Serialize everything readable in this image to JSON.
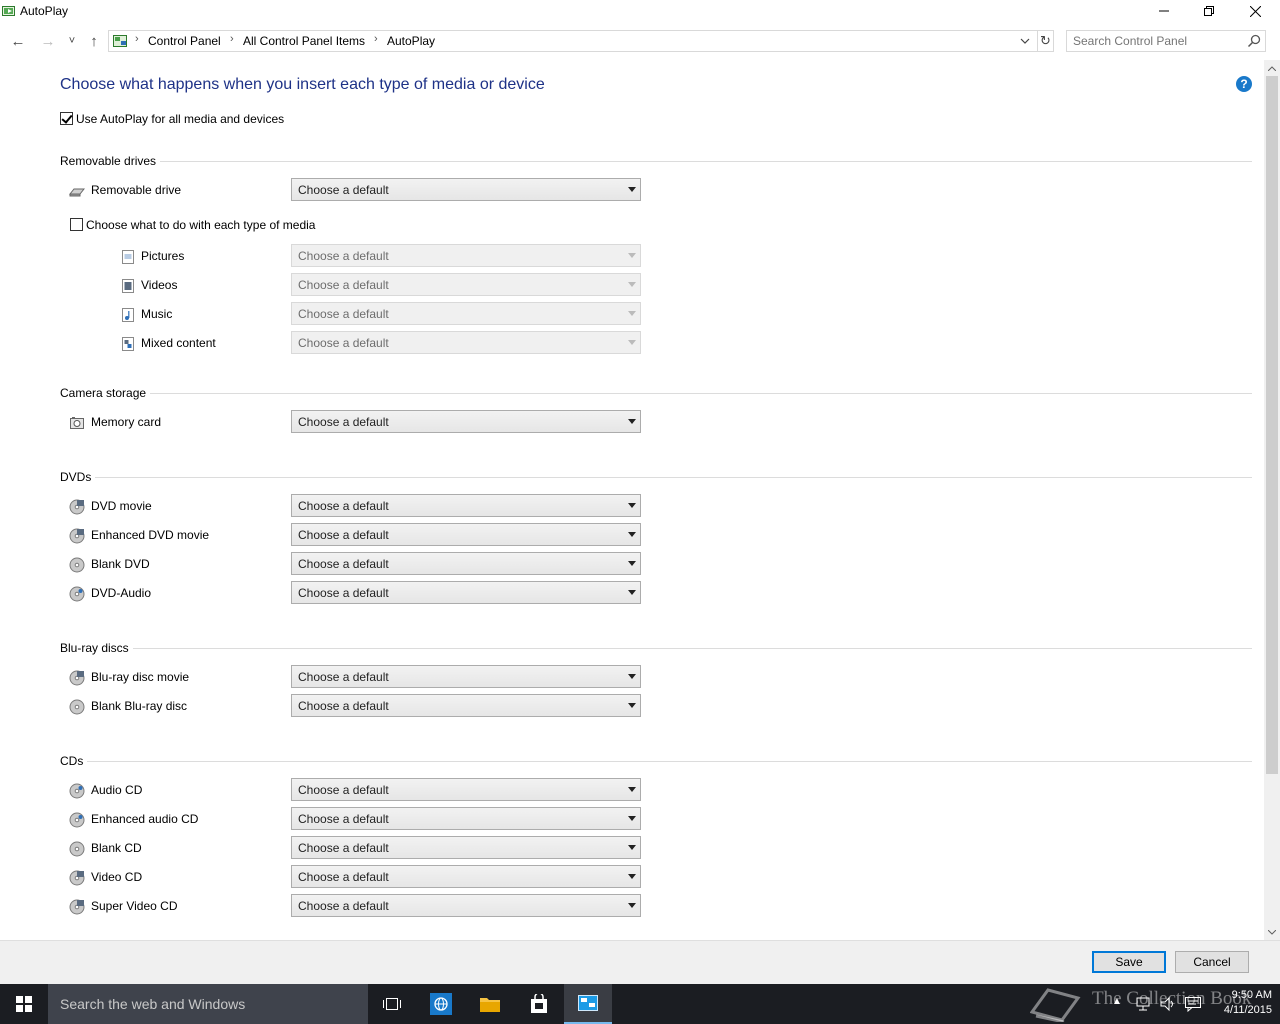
{
  "window": {
    "title": "AutoPlay",
    "controls": {
      "minimize": "─",
      "maximize": "❐",
      "close": "✕"
    }
  },
  "nav": {
    "back": "←",
    "forward": "→",
    "recent": "˅",
    "up": "↑",
    "breadcrumb": [
      "Control Panel",
      "All Control Panel Items",
      "AutoPlay"
    ],
    "refresh": "↻",
    "search_placeholder": "Search Control Panel"
  },
  "main": {
    "heading": "Choose what happens when you insert each type of media or device",
    "use_autoplay_label": "Use AutoPlay for all media and devices",
    "use_autoplay_checked": true,
    "help": "?",
    "default_choice": "Choose a default",
    "sections": {
      "removable": {
        "title": "Removable drives",
        "items": [
          {
            "label": "Removable drive",
            "icon": "removable-drive-icon"
          }
        ],
        "per_media_label": "Choose what to do with each type of media",
        "per_media_checked": false,
        "media": [
          {
            "label": "Pictures",
            "icon": "pictures-icon"
          },
          {
            "label": "Videos",
            "icon": "videos-icon"
          },
          {
            "label": "Music",
            "icon": "music-icon"
          },
          {
            "label": "Mixed content",
            "icon": "mixed-content-icon"
          }
        ]
      },
      "camera": {
        "title": "Camera storage",
        "items": [
          {
            "label": "Memory card",
            "icon": "memory-card-icon"
          }
        ]
      },
      "dvds": {
        "title": "DVDs",
        "items": [
          {
            "label": "DVD movie",
            "icon": "dvd-movie-icon"
          },
          {
            "label": "Enhanced DVD movie",
            "icon": "enhanced-dvd-icon"
          },
          {
            "label": "Blank DVD",
            "icon": "blank-dvd-icon"
          },
          {
            "label": "DVD-Audio",
            "icon": "dvd-audio-icon"
          }
        ]
      },
      "bluray": {
        "title": "Blu-ray discs",
        "items": [
          {
            "label": "Blu-ray disc movie",
            "icon": "bluray-movie-icon"
          },
          {
            "label": "Blank Blu-ray disc",
            "icon": "blank-bluray-icon"
          }
        ]
      },
      "cds": {
        "title": "CDs",
        "items": [
          {
            "label": "Audio CD",
            "icon": "audio-cd-icon"
          },
          {
            "label": "Enhanced audio CD",
            "icon": "enhanced-audio-cd-icon"
          },
          {
            "label": "Blank CD",
            "icon": "blank-cd-icon"
          },
          {
            "label": "Video CD",
            "icon": "video-cd-icon"
          },
          {
            "label": "Super Video CD",
            "icon": "super-video-cd-icon"
          }
        ]
      }
    }
  },
  "footer": {
    "save": "Save",
    "cancel": "Cancel"
  },
  "taskbar": {
    "search_text": "Search the web and Windows",
    "time": "9:50 AM",
    "date": "4/11/2015",
    "watermark": "The Collection Book"
  }
}
